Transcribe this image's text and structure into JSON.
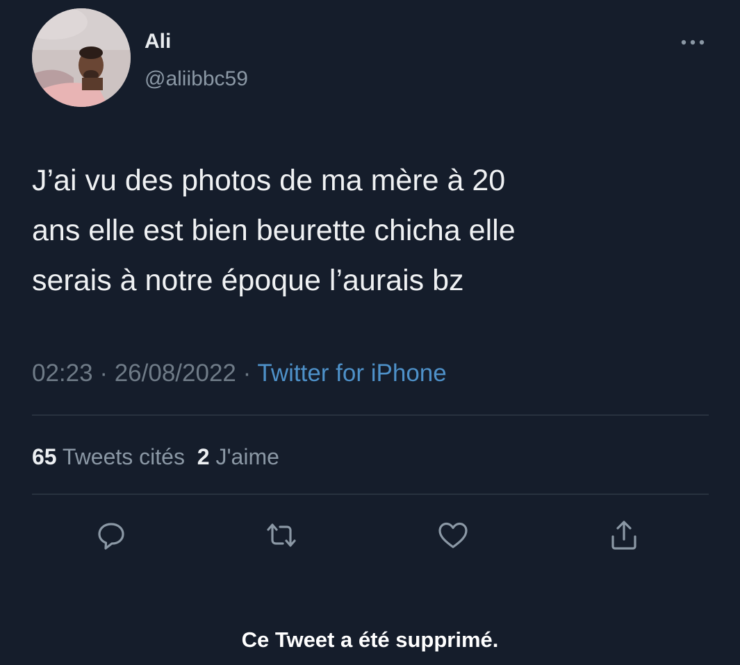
{
  "tweet": {
    "author": {
      "display_name": "Ali",
      "handle": "@aliibbc59"
    },
    "text_lines": [
      "J’ai vu des photos de ma mère à 20",
      "ans elle est bien beurette chicha elle",
      "serais à notre époque l’aurais bz"
    ],
    "time": "02:23",
    "date": "26/08/2022",
    "separator": "·",
    "source": "Twitter for iPhone",
    "stats": {
      "quotes_count": "65",
      "quotes_label": "Tweets cités",
      "likes_count": "2",
      "likes_label": "J'aime"
    },
    "actions": [
      {
        "icon": "reply-icon"
      },
      {
        "icon": "retweet-icon"
      },
      {
        "icon": "like-icon"
      },
      {
        "icon": "share-icon"
      }
    ]
  },
  "notice": "Ce Tweet a été supprimé.",
  "colors": {
    "background": "#151d2b",
    "text": "#eff1f3",
    "secondary_text": "#8b98a5",
    "link": "#4e91c9",
    "divider": "#28323f"
  }
}
